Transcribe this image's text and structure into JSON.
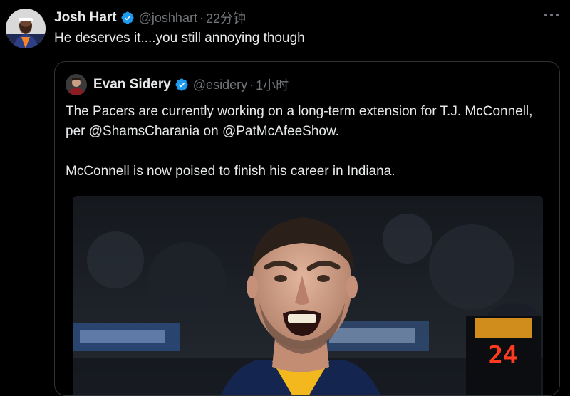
{
  "tweet": {
    "author_name": "Josh Hart",
    "handle": "@joshhart",
    "separator": "·",
    "time": "22分钟",
    "text": "He deserves it....you still annoying though",
    "avatar_icon": "avatar-image",
    "verified_icon": "verified-badge-icon",
    "more_icon": "more-options-icon"
  },
  "quote": {
    "author_name": "Evan Sidery",
    "handle": "@esidery",
    "separator": "·",
    "time": "1小时",
    "paragraph1": "The Pacers are currently working on a long-term extension for T.J. McConnell, per @ShamsCharania on @PatMcAfeeShow.",
    "paragraph2": "McConnell is now poised to finish his career in Indiana.",
    "media_icon": "photo-player-celebrating",
    "scoreboard_value": "24"
  },
  "colors": {
    "background": "#000000",
    "text_primary": "#e7e9ea",
    "text_secondary": "#71767b",
    "border": "#2f3336",
    "verified": "#1d9bf0",
    "shot_clock": "#ff3b1f"
  }
}
